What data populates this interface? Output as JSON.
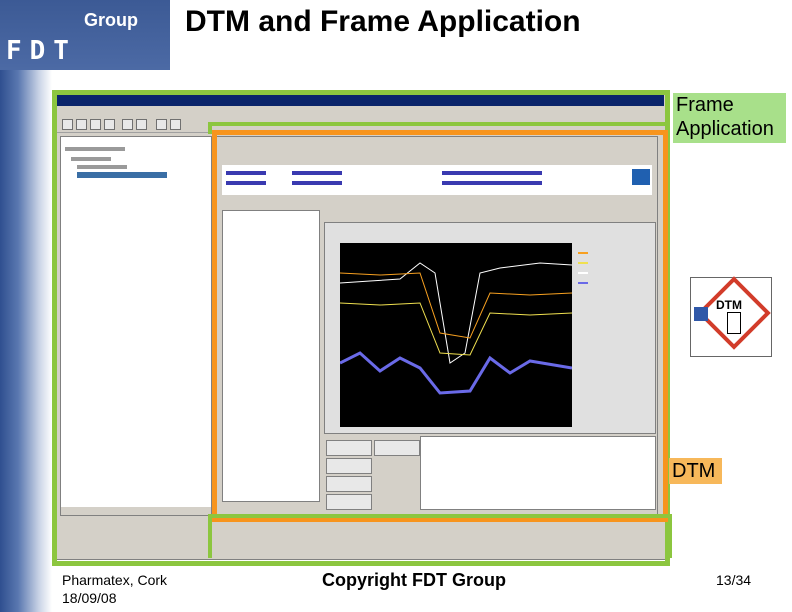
{
  "slide": {
    "brand_group": "Group",
    "brand_fdt": "FDT",
    "title": "DTM and Frame Application"
  },
  "labels": {
    "frame_application": "Frame Application",
    "dtm": "DTM",
    "dtm_icon_text": "DTM"
  },
  "footer": {
    "location": "Pharmatex, Cork",
    "date": "18/09/08",
    "copyright": "Copyright FDT Group",
    "page": "13/34"
  },
  "colors": {
    "frame_app_green": "#8cc63f",
    "dtm_orange": "#f7941d",
    "fdt_blue": "#3c5a95"
  }
}
